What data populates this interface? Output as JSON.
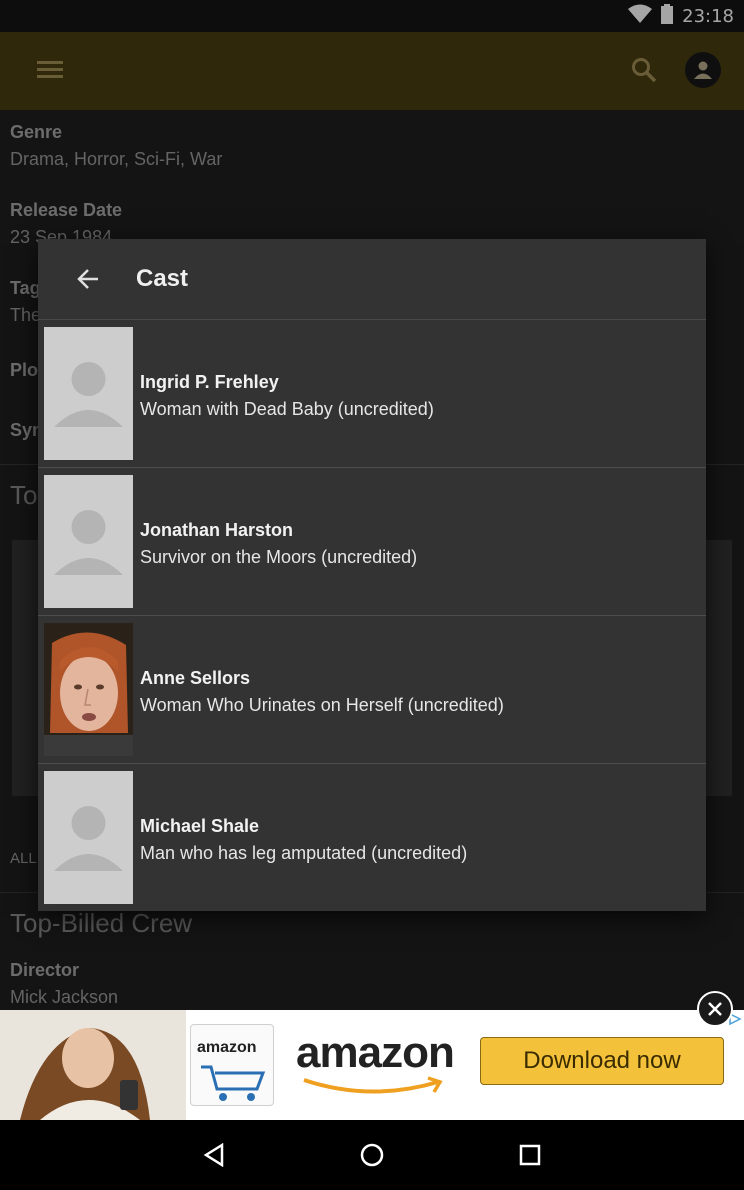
{
  "status_bar": {
    "time": "23:18"
  },
  "app_bar": {
    "menu_icon": "menu-icon",
    "search_icon": "search-icon",
    "account_icon": "account-icon"
  },
  "background": {
    "genre_label": "Genre",
    "genre_value": "Drama, Horror, Sci-Fi, War",
    "release_label": "Release Date",
    "release_value": "23 Sep 1984",
    "tagline_label": "Tag",
    "tagline_value": "The",
    "plot_label": "Plo",
    "synopsis_label": "Syn",
    "top_cast_heading": "Top",
    "all_link": "ALL",
    "crew_heading": "Top-Billed Crew",
    "director_label": "Director",
    "director_value": "Mick Jackson"
  },
  "dialog": {
    "title": "Cast",
    "back_icon": "arrow-back-icon",
    "cast": [
      {
        "name": "Ingrid P. Frehley",
        "role": "Woman with Dead Baby (uncredited)",
        "photo": "placeholder"
      },
      {
        "name": "Jonathan Harston",
        "role": "Survivor on the Moors (uncredited)",
        "photo": "placeholder"
      },
      {
        "name": "Anne Sellors",
        "role": "Woman Who Urinates on Herself (uncredited)",
        "photo": "portrait"
      },
      {
        "name": "Michael Shale",
        "role": "Man who has leg amputated (uncredited)",
        "photo": "placeholder"
      }
    ]
  },
  "ad": {
    "logo_text": "amazon",
    "brand_text": "amazon",
    "cta_label": "Download now",
    "accent": "#f3c23a"
  },
  "nav_bar": {
    "back_icon": "nav-back-icon",
    "home_icon": "nav-home-icon",
    "recents_icon": "nav-recents-icon"
  }
}
